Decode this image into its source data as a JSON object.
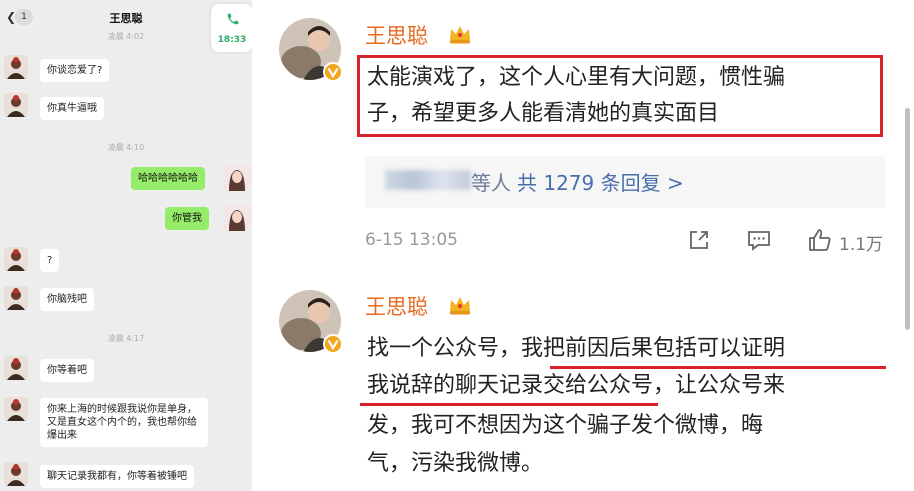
{
  "chat": {
    "unread": "1",
    "contact_name": "王思聪",
    "call_time": "18:33",
    "top_timestamp": "凌晨 4:02",
    "messages": [
      {
        "side": "left",
        "text": "你谈恋爱了?"
      },
      {
        "side": "left",
        "text": "你真牛逼哦"
      },
      {
        "side": "time",
        "text": "凌晨 4:10"
      },
      {
        "side": "right",
        "text": "哈哈哈哈哈哈"
      },
      {
        "side": "right",
        "text": "你管我"
      },
      {
        "side": "left",
        "text": "?"
      },
      {
        "side": "left",
        "text": "你脑残吧"
      },
      {
        "side": "time",
        "text": "凌晨 4:17"
      },
      {
        "side": "left",
        "text": "你等着吧"
      },
      {
        "side": "left",
        "text": "你来上海的时候跟我说你是单身，又是直女这个内个的，我也帮你给爆出来"
      },
      {
        "side": "left",
        "text": "聊天记录我都有，你等着被锤吧"
      }
    ]
  },
  "weibo": {
    "comment1": {
      "username": "王思聪",
      "text_line1": "太能演戏了，这个人心里有大问题，惯性骗",
      "text_line2": "子，希望更多人能看清她的真实面目",
      "reply_suffix": "等人",
      "reply_count_text": "共 1279 条回复 >",
      "date": "6-15 13:05",
      "likes": "1.1万"
    },
    "comment2": {
      "username": "王思聪",
      "line1_plain": "找一个公众号，",
      "line1_underlined": "我把前因后果包括可以证明",
      "line2_underlined": "我说辞的聊天记录交给公众号",
      "line2_plain": "，让公众号来",
      "line3": "发，我可不想因为这个骗子发个微博，晦",
      "line4": "气，污染我微博。"
    },
    "icons": [
      "share-icon",
      "comment-icon",
      "like-icon",
      "crown-badge-icon",
      "verified-v-icon"
    ],
    "colors": {
      "username": "#e86a1f",
      "highlight": "#d8232a",
      "link": "#4a6ea8",
      "wechat_green": "#95ec69"
    }
  }
}
